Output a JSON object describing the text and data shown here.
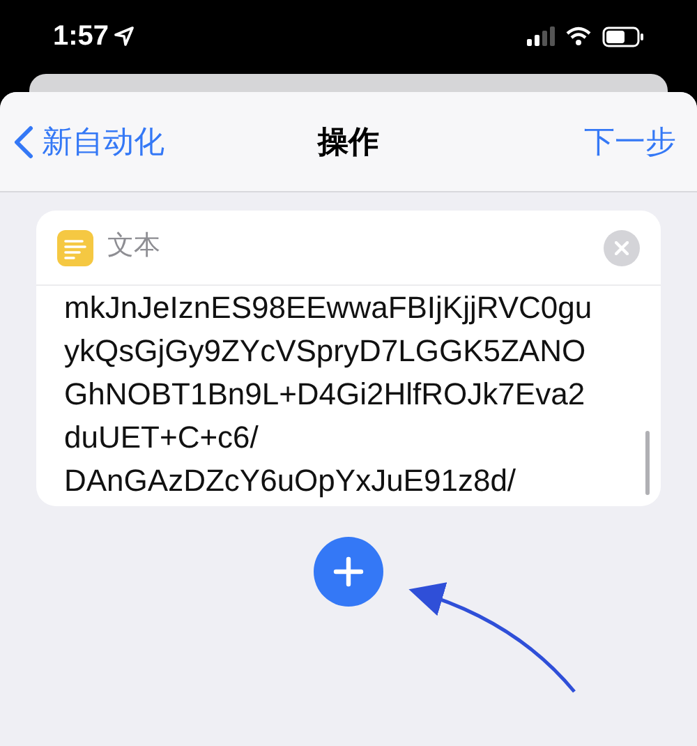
{
  "status_bar": {
    "time": "1:57"
  },
  "nav": {
    "back": "新自动化",
    "title": "操作",
    "next": "下一步"
  },
  "action": {
    "title": "文本",
    "lines": [
      "mkJnJeIznES98EEwwaFBIjKjjRVC0gu",
      "ykQsGjGy9ZYcVSpryD7LGGK5ZANO",
      "GhNOBT1Bn9L+D4Gi2HlfROJk7Eva2",
      "duUET+C+c6/",
      "DAnGAzDZcY6uOpYxJuE91z8d/"
    ]
  }
}
